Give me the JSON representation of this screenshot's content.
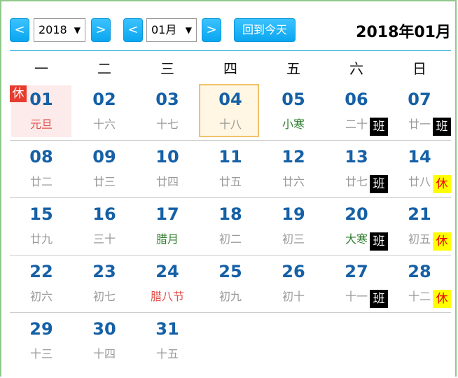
{
  "controls": {
    "prev_year": "<",
    "year_value": "2018",
    "next_year": ">",
    "prev_month": "<",
    "month_value": "01月",
    "next_month": ">",
    "today_button": "回到今天",
    "caret": "▼"
  },
  "title": "2018年01月",
  "weekdays": [
    "一",
    "二",
    "三",
    "四",
    "五",
    "六",
    "日"
  ],
  "badges": {
    "work": "班",
    "rest": "休"
  },
  "days": [
    {
      "day": "01",
      "lunar": "元旦",
      "lunar_type": "holiday",
      "badge": "rest-red",
      "highlight": "holiday"
    },
    {
      "day": "02",
      "lunar": "十六"
    },
    {
      "day": "03",
      "lunar": "十七"
    },
    {
      "day": "04",
      "lunar": "十八",
      "highlight": "today"
    },
    {
      "day": "05",
      "lunar": "小寒",
      "lunar_type": "term"
    },
    {
      "day": "06",
      "lunar": "二十",
      "badge": "work"
    },
    {
      "day": "07",
      "lunar": "廿一",
      "badge": "work"
    },
    {
      "day": "08",
      "lunar": "廿二"
    },
    {
      "day": "09",
      "lunar": "廿三"
    },
    {
      "day": "10",
      "lunar": "廿四"
    },
    {
      "day": "11",
      "lunar": "廿五"
    },
    {
      "day": "12",
      "lunar": "廿六"
    },
    {
      "day": "13",
      "lunar": "廿七",
      "badge": "work"
    },
    {
      "day": "14",
      "lunar": "廿八",
      "badge": "rest"
    },
    {
      "day": "15",
      "lunar": "廿九"
    },
    {
      "day": "16",
      "lunar": "三十"
    },
    {
      "day": "17",
      "lunar": "腊月",
      "lunar_type": "term"
    },
    {
      "day": "18",
      "lunar": "初二"
    },
    {
      "day": "19",
      "lunar": "初三"
    },
    {
      "day": "20",
      "lunar": "大寒",
      "lunar_type": "term",
      "badge": "work"
    },
    {
      "day": "21",
      "lunar": "初五",
      "badge": "rest"
    },
    {
      "day": "22",
      "lunar": "初六"
    },
    {
      "day": "23",
      "lunar": "初七"
    },
    {
      "day": "24",
      "lunar": "腊八节",
      "lunar_type": "holiday"
    },
    {
      "day": "25",
      "lunar": "初九"
    },
    {
      "day": "26",
      "lunar": "初十"
    },
    {
      "day": "27",
      "lunar": "十一",
      "badge": "work"
    },
    {
      "day": "28",
      "lunar": "十二",
      "badge": "rest"
    },
    {
      "day": "29",
      "lunar": "十三"
    },
    {
      "day": "30",
      "lunar": "十四"
    },
    {
      "day": "31",
      "lunar": "十五"
    }
  ]
}
